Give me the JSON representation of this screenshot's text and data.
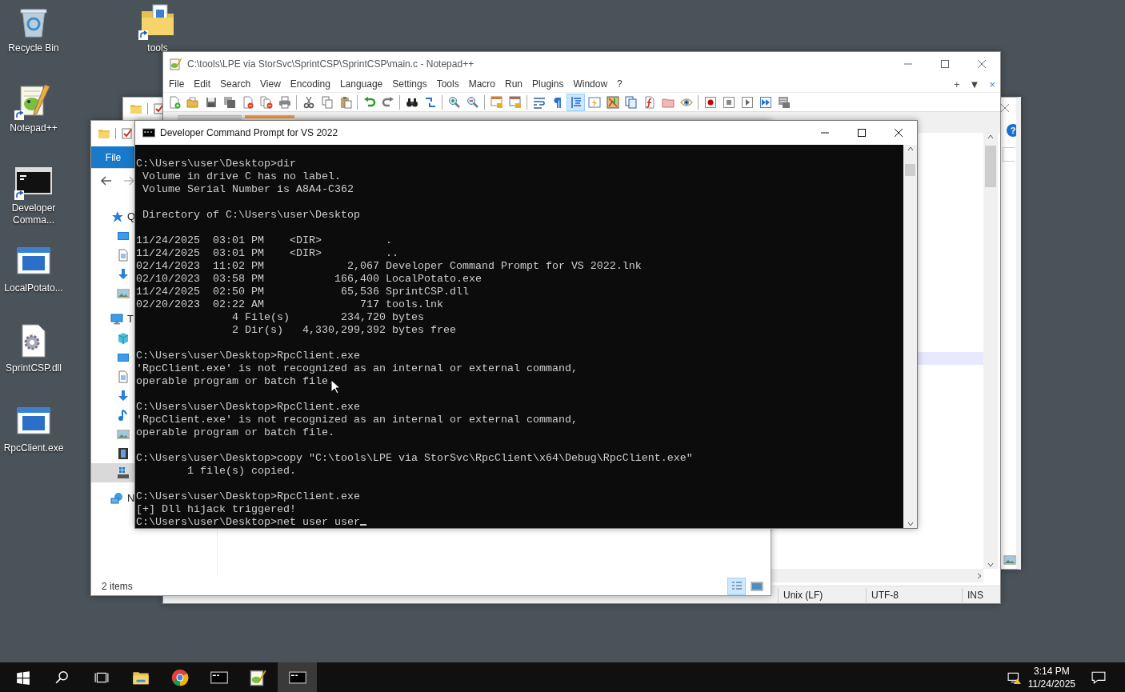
{
  "desktop_icons": [
    {
      "label": "Recycle Bin",
      "kind": "recycle",
      "shortcut": false
    },
    {
      "label": "tools",
      "kind": "folder",
      "shortcut": true
    },
    {
      "label": "Notepad++",
      "kind": "notepad",
      "shortcut": true
    },
    {
      "label": "Developer Comma...",
      "kind": "console",
      "shortcut": true
    },
    {
      "label": "LocalPotato...",
      "kind": "app",
      "shortcut": false
    },
    {
      "label": "SprintCSP.dll",
      "kind": "dll",
      "shortcut": false
    },
    {
      "label": "RpcClient.exe",
      "kind": "app",
      "shortcut": false
    }
  ],
  "back_explorer": {
    "help": "?"
  },
  "notepad": {
    "title": "C:\\tools\\LPE via StorSvc\\SprintCSP\\SprintCSP\\main.c - Notepad++",
    "menu": [
      "File",
      "Edit",
      "Search",
      "View",
      "Encoding",
      "Language",
      "Settings",
      "Tools",
      "Macro",
      "Run",
      "Plugins",
      "Window",
      "?"
    ],
    "menu_right": [
      "+",
      "▼",
      "×"
    ],
    "toolbar": [
      [
        {
          "kind": "new",
          "selected": false
        },
        {
          "kind": "open",
          "selected": false
        },
        {
          "kind": "save",
          "selected": false
        },
        {
          "kind": "saveall",
          "selected": false
        },
        {
          "kind": "close",
          "selected": false
        },
        {
          "kind": "closeall",
          "selected": false
        },
        {
          "kind": "print",
          "selected": false
        }
      ],
      [
        {
          "kind": "cut",
          "selected": false
        },
        {
          "kind": "copy",
          "selected": false
        },
        {
          "kind": "paste",
          "selected": false
        }
      ],
      [
        {
          "kind": "undo",
          "selected": false
        },
        {
          "kind": "redo",
          "selected": false
        }
      ],
      [
        {
          "kind": "find",
          "selected": false
        },
        {
          "kind": "replace",
          "selected": false
        }
      ],
      [
        {
          "kind": "zoomin",
          "selected": false
        },
        {
          "kind": "zoomout",
          "selected": false
        }
      ],
      [
        {
          "kind": "syncv",
          "selected": false
        },
        {
          "kind": "synch",
          "selected": false
        }
      ],
      [
        {
          "kind": "wrap",
          "selected": false
        },
        {
          "kind": "pilcrow",
          "selected": false
        },
        {
          "kind": "indent",
          "selected": true
        },
        {
          "kind": "udl",
          "selected": false
        },
        {
          "kind": "map",
          "selected": false
        },
        {
          "kind": "doclist",
          "selected": false
        },
        {
          "kind": "func",
          "selected": false
        },
        {
          "kind": "wsfolder",
          "selected": false
        },
        {
          "kind": "monitor",
          "selected": false
        }
      ],
      [
        {
          "kind": "record",
          "selected": false
        },
        {
          "kind": "stop",
          "selected": false
        },
        {
          "kind": "play",
          "selected": false
        },
        {
          "kind": "playmulti",
          "selected": false
        },
        {
          "kind": "savemacro",
          "selected": false
        }
      ]
    ],
    "tabs": [
      {
        "selected": false
      },
      {
        "selected": true
      }
    ],
    "status_bar": [
      "Unix (LF)",
      "UTF-8",
      "INS"
    ]
  },
  "explorer": {
    "ribbon_tab": "File",
    "nav": [
      {
        "kind": "star",
        "label": "Q",
        "head": true,
        "selected": false
      },
      {
        "kind": "desktop",
        "head": false,
        "selected": false
      },
      {
        "kind": "document",
        "head": false,
        "selected": false
      },
      {
        "kind": "download",
        "head": false,
        "selected": false
      },
      {
        "kind": "picture",
        "head": false,
        "selected": false
      },
      {
        "kind": "pc",
        "label": "T",
        "head": true,
        "selected": false
      },
      {
        "kind": "cube",
        "head": false,
        "selected": false
      },
      {
        "kind": "desktop",
        "head": false,
        "selected": false
      },
      {
        "kind": "document",
        "head": false,
        "selected": false
      },
      {
        "kind": "download",
        "head": false,
        "selected": false
      },
      {
        "kind": "music",
        "head": false,
        "selected": false
      },
      {
        "kind": "picture",
        "head": false,
        "selected": false
      },
      {
        "kind": "video",
        "head": false,
        "selected": false
      },
      {
        "kind": "drive",
        "head": false,
        "selected": true
      },
      {
        "kind": "network",
        "label": "N",
        "head": true,
        "selected": false
      }
    ],
    "status": "2 items",
    "views": [
      {
        "kind": "details",
        "selected": true
      },
      {
        "kind": "tiles",
        "selected": false
      }
    ]
  },
  "console": {
    "title": "Developer Command Prompt for VS 2022",
    "blocks": [
      [
        "C:\\Users\\user\\Desktop>dir",
        " Volume in drive C has no label.",
        " Volume Serial Number is A8A4-C362"
      ],
      [
        " Directory of C:\\Users\\user\\Desktop"
      ],
      [
        "11/24/2025  03:01 PM    <DIR>          .",
        "11/24/2025  03:01 PM    <DIR>          ..",
        "02/14/2023  11:02 PM             2,067 Developer Command Prompt for VS 2022.lnk",
        "02/10/2023  03:58 PM           166,400 LocalPotato.exe",
        "11/24/2025  02:50 PM            65,536 SprintCSP.dll",
        "02/20/2023  02:22 AM               717 tools.lnk",
        "               4 File(s)        234,720 bytes",
        "               2 Dir(s)   4,330,299,392 bytes free"
      ],
      [
        "C:\\Users\\user\\Desktop>RpcClient.exe",
        "'RpcClient.exe' is not recognized as an internal or external command,",
        "operable program or batch file."
      ],
      [
        "C:\\Users\\user\\Desktop>RpcClient.exe",
        "'RpcClient.exe' is not recognized as an internal or external command,",
        "operable program or batch file."
      ],
      [
        "C:\\Users\\user\\Desktop>copy \"C:\\tools\\LPE via StorSvc\\RpcClient\\x64\\Debug\\RpcClient.exe\"",
        "        1 file(s) copied."
      ],
      [
        "C:\\Users\\user\\Desktop>RpcClient.exe",
        "[+] Dll hijack triggered!",
        "C:\\Users\\user\\Desktop>net user user"
      ]
    ],
    "cursor": true
  },
  "taskbar": {
    "buttons": [
      {
        "kind": "start"
      },
      {
        "kind": "search"
      },
      {
        "kind": "taskview"
      }
    ],
    "apps": [
      {
        "kind": "explorer",
        "selected": false
      },
      {
        "kind": "browser",
        "selected": false
      },
      {
        "kind": "console",
        "selected": false
      },
      {
        "kind": "notepad",
        "selected": false
      },
      {
        "kind": "console",
        "selected": true
      }
    ],
    "time": "3:14 PM",
    "date": "11/24/2025"
  }
}
